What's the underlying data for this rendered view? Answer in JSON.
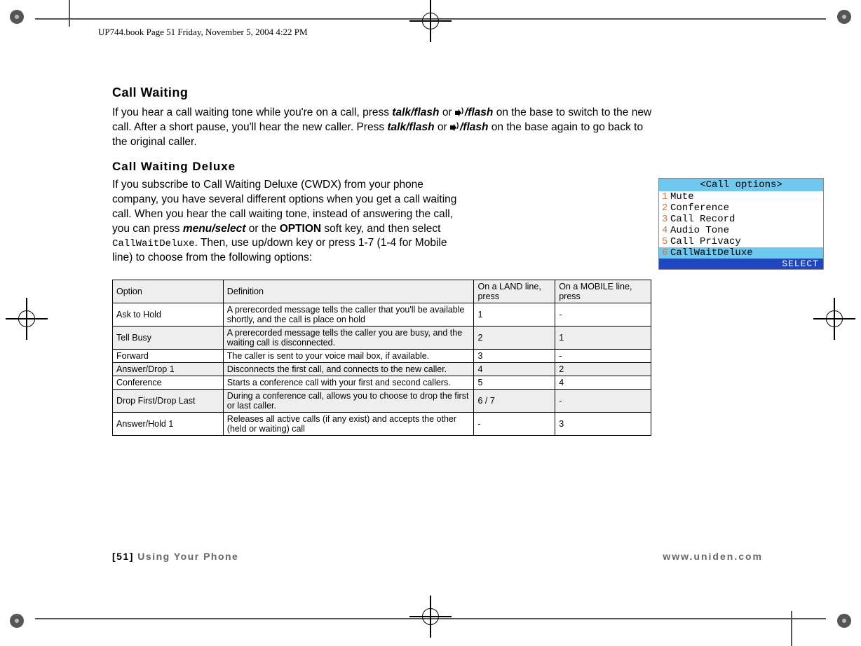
{
  "header": {
    "line": "UP744.book  Page 51  Friday, November 5, 2004  4:22 PM"
  },
  "sections": {
    "call_waiting": {
      "title": "Call Waiting",
      "para_1a": "If you hear a call waiting tone while you're on a call, press ",
      "talk_flash": "talk/flash",
      "or": " or ",
      "slash_flash": "/flash",
      "para_1b": " on the base to switch to the new call. After a short pause, you'll hear the new caller. Press ",
      "para_1c": " on the base again to go back to the original caller."
    },
    "cwdx": {
      "title": "Call Waiting Deluxe",
      "para_a": "If you subscribe to Call Waiting Deluxe (CWDX) from your phone company, you have several different options when you get a call waiting call. When you hear the call waiting tone, instead of answering the call, you can press ",
      "menu_select": "menu/select",
      "or_the": " or the ",
      "option_label": "OPTION",
      "para_b": " soft key, and then select ",
      "lcd_item": "CallWaitDeluxe",
      "para_c": ". Then, use up/down key or press 1-7 (1-4 for Mobile line) to choose from the following options:"
    }
  },
  "phone_screen": {
    "title": "<Call options>",
    "items": [
      {
        "n": "1",
        "label": "Mute"
      },
      {
        "n": "2",
        "label": "Conference"
      },
      {
        "n": "3",
        "label": "Call Record"
      },
      {
        "n": "4",
        "label": "Audio Tone"
      },
      {
        "n": "5",
        "label": "Call Privacy"
      },
      {
        "n": "6",
        "label": "CallWaitDeluxe"
      }
    ],
    "softkey": "SELECT"
  },
  "table": {
    "headers": {
      "option": "Option",
      "definition": " Definition",
      "land": "On a LAND line, press",
      "mobile": "On a MOBILE line, press"
    },
    "rows": [
      {
        "option": "Ask to Hold",
        "definition": "A prerecorded message tells the caller that you'll be available shortly, and the call is place on hold",
        "land": "1",
        "mobile": "-"
      },
      {
        "option": "Tell Busy",
        "definition": " A prerecorded message tells the caller you are busy, and the waiting call is disconnected.",
        "land": "2",
        "mobile": "1"
      },
      {
        "option": "Forward",
        "definition": "The caller is sent to your voice mail box, if available.",
        "land": "3",
        "mobile": "-"
      },
      {
        "option": "Answer/Drop 1",
        "definition": " Disconnects the first call, and connects to the new caller.",
        "land": "4",
        "mobile": "2"
      },
      {
        "option": "Conference",
        "definition": "Starts a conference call with your first and second callers.",
        "land": "5",
        "mobile": "4"
      },
      {
        "option": "Drop First/Drop Last",
        "definition": "During a conference call, allows you to choose to drop the first or last caller.",
        "land": "6 / 7",
        "mobile": "-"
      },
      {
        "option": "Answer/Hold 1",
        "definition": "Releases all active calls (if any exist) and accepts the other (held or waiting) call",
        "land": "-",
        "mobile": "3"
      }
    ]
  },
  "footer": {
    "page_prefix": "[51] ",
    "page_text": "Using Your Phone",
    "url": "www.uniden.com"
  }
}
